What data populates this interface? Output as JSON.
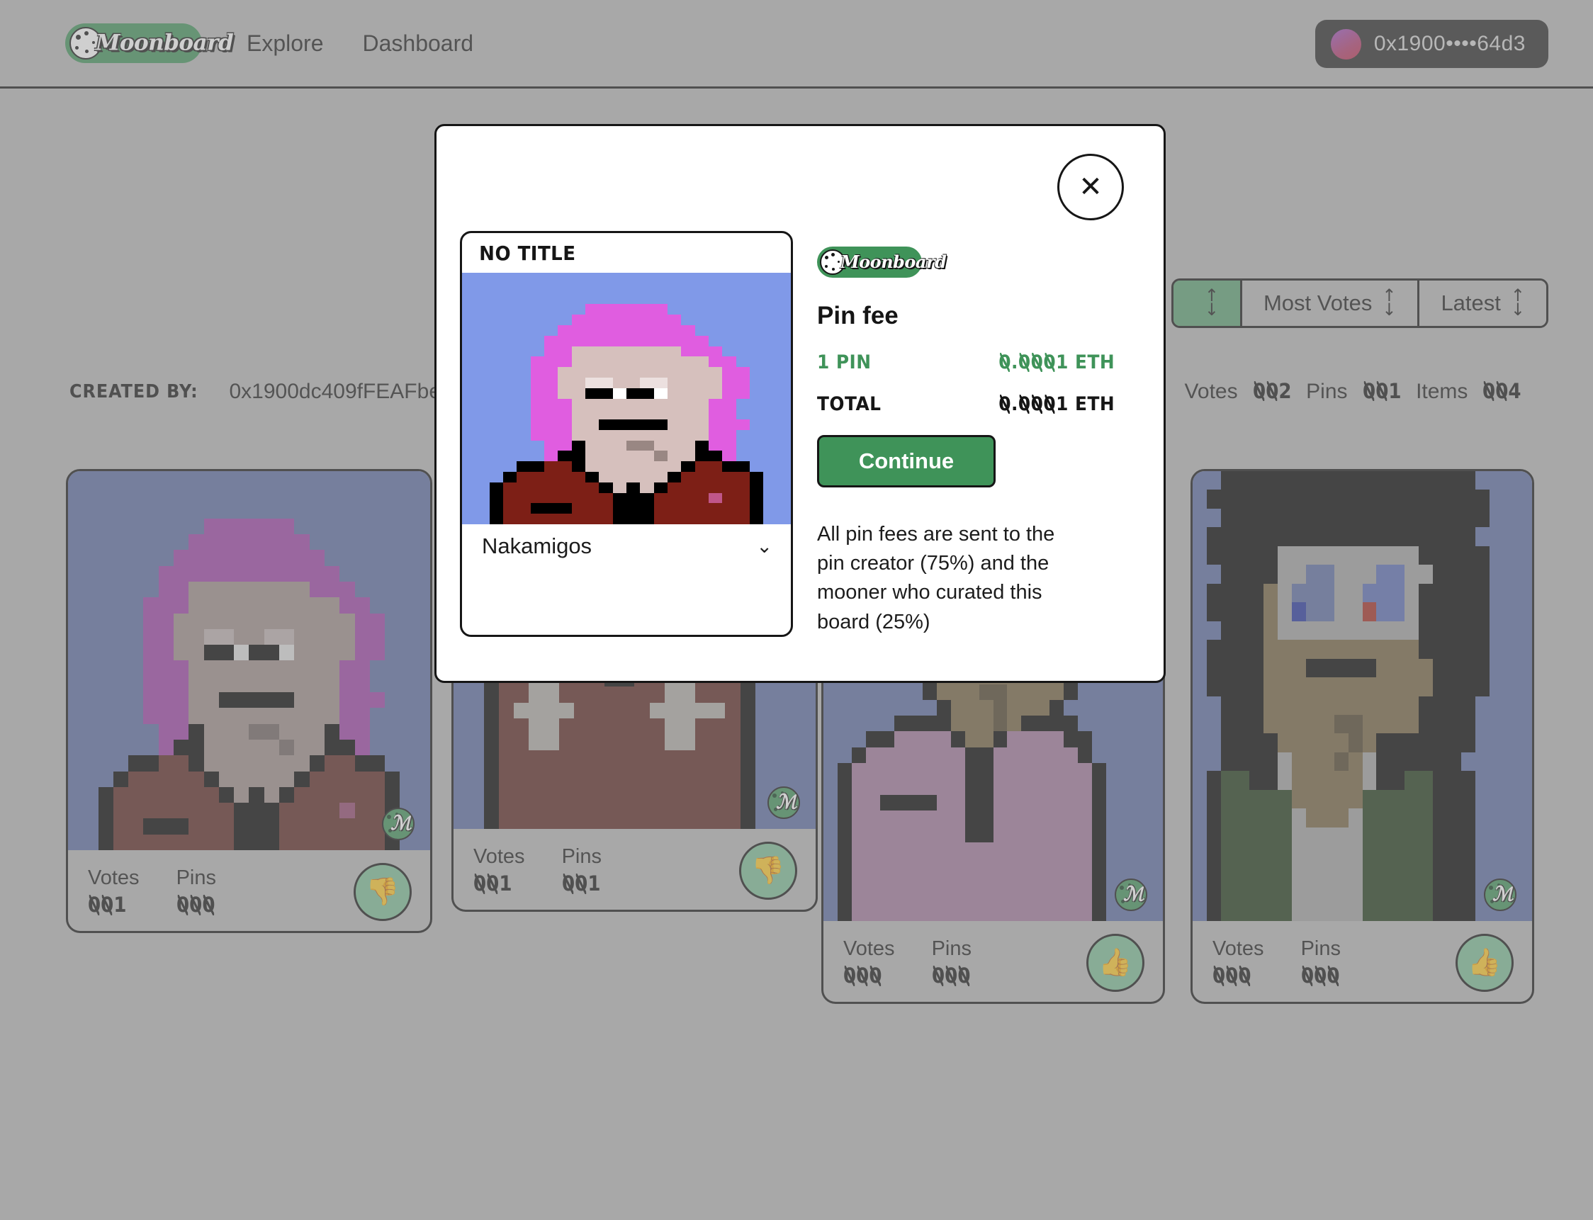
{
  "header": {
    "logo_text": "Moonboard",
    "logo_icon": "moon-cookie-icon",
    "nav": [
      {
        "label": "Explore"
      },
      {
        "label": "Dashboard"
      }
    ],
    "wallet": {
      "address": "0x1900••••64d3",
      "avatar_gradient": "#9b4fc4 → #c0304a"
    }
  },
  "board": {
    "created_by_label": "CREATED BY:",
    "created_by_address": "0x1900dc409fFEAFbe",
    "stats": [
      {
        "label": "Votes",
        "value": "002"
      },
      {
        "label": "Pins",
        "value": "001"
      },
      {
        "label": "Items",
        "value": "004"
      }
    ],
    "sort_buttons": [
      {
        "label": "",
        "icon": "sort-updown-icon",
        "active": true
      },
      {
        "label": "Most Votes",
        "icon": "sort-updown-icon",
        "active": false
      },
      {
        "label": "Latest",
        "icon": "sort-updown-icon",
        "active": false
      }
    ]
  },
  "cards": [
    {
      "votes_label": "Votes",
      "votes_value": "001",
      "pins_label": "Pins",
      "pins_value": "000",
      "vote_icon": "thumbs-down-icon",
      "badge": "moonboard-m-badge"
    },
    {
      "votes_label": "Votes",
      "votes_value": "001",
      "pins_label": "Pins",
      "pins_value": "001",
      "vote_icon": "thumbs-down-icon",
      "badge": "moonboard-m-badge"
    },
    {
      "votes_label": "Votes",
      "votes_value": "000",
      "pins_label": "Pins",
      "pins_value": "000",
      "vote_icon": "thumbs-up-icon",
      "badge": "moonboard-m-badge"
    },
    {
      "votes_label": "Votes",
      "votes_value": "000",
      "pins_label": "Pins",
      "pins_value": "000",
      "vote_icon": "thumbs-up-icon",
      "badge": "moonboard-m-badge"
    }
  ],
  "modal": {
    "close_icon": "close-x-icon",
    "item": {
      "title": "NO TITLE",
      "collection": "Nakamigos",
      "chevron_icon": "chevron-down-icon"
    },
    "logo_text": "Moonboard",
    "heading": "Pin fee",
    "rows": [
      {
        "key": "1 PIN",
        "value": "0.0001 ETH",
        "color": "#3f9359"
      },
      {
        "key": "TOTAL",
        "value": "0.0001 ETH",
        "color": "#161616"
      }
    ],
    "continue_label": "Continue",
    "disclaimer": "All pin fees are sent to the pin creator (75%) and the mooner who curated this board (25%)"
  },
  "colors": {
    "page_bg": "#b7b7b7",
    "brand_green": "#3f9359",
    "vote_green": "#7dbf97",
    "ink": "#161616",
    "nft_bg_blue": "#8099e8",
    "nft_bg_blue_dim": "#5c6ca3"
  }
}
